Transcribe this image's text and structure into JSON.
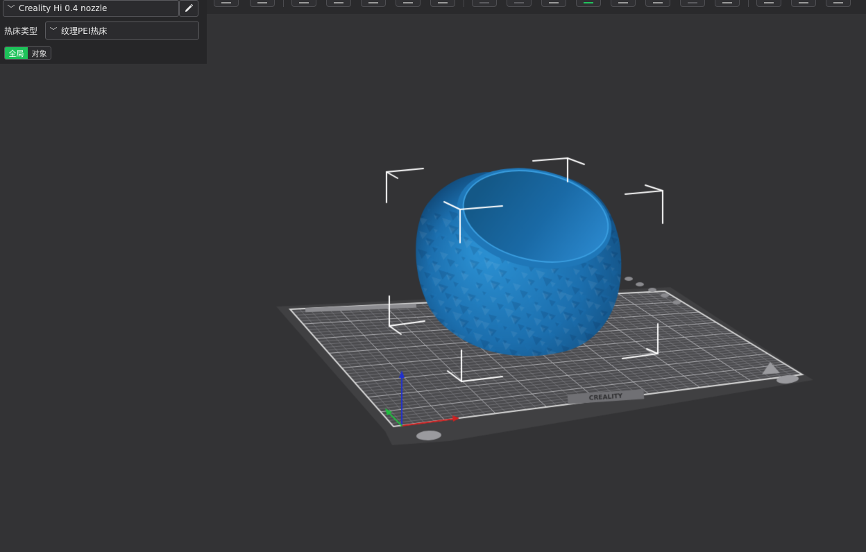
{
  "printer": {
    "selected": "Creality Hi 0.4 nozzle",
    "chevron_icon": "chevron-down-icon",
    "edit_icon": "pencil-icon"
  },
  "bed": {
    "label": "热床类型",
    "selected": "纹理PEI热床"
  },
  "scope": {
    "global_label": "全局",
    "object_label": "对象",
    "active": "global",
    "active_color": "#1ec25a"
  },
  "viewport": {
    "background": "#333335",
    "plate_brand": "CREALITY",
    "model_color": "#1a6aa6",
    "axis_colors": {
      "x": "#d02020",
      "y": "#20c040",
      "z": "#2030d0"
    }
  },
  "toolbar": {
    "buttons": [
      {
        "icon": "add-object-icon",
        "enabled": true
      },
      {
        "icon": "plate-icon",
        "enabled": true
      },
      {
        "icon": "orient-icon",
        "enabled": true
      },
      {
        "icon": "arrange-icon",
        "enabled": true
      },
      {
        "icon": "auto-orient-icon",
        "enabled": true,
        "accent": false
      },
      {
        "icon": "layout-icon",
        "enabled": true
      },
      {
        "icon": "split-icon",
        "enabled": true
      },
      {
        "icon": "copy-icon",
        "enabled": false
      },
      {
        "icon": "mirror-icon",
        "enabled": false
      },
      {
        "icon": "measure-icon",
        "enabled": true
      },
      {
        "icon": "paint-support-icon",
        "enabled": true,
        "accent": true
      },
      {
        "icon": "seam-icon",
        "enabled": true
      },
      {
        "icon": "cut-icon",
        "enabled": true
      },
      {
        "icon": "text-icon",
        "enabled": false
      },
      {
        "icon": "variable-layer-icon",
        "enabled": true
      },
      {
        "icon": "scale-icon",
        "enabled": true
      },
      {
        "icon": "slice-view-icon",
        "enabled": true
      },
      {
        "icon": "assembly-icon",
        "enabled": true
      }
    ]
  }
}
